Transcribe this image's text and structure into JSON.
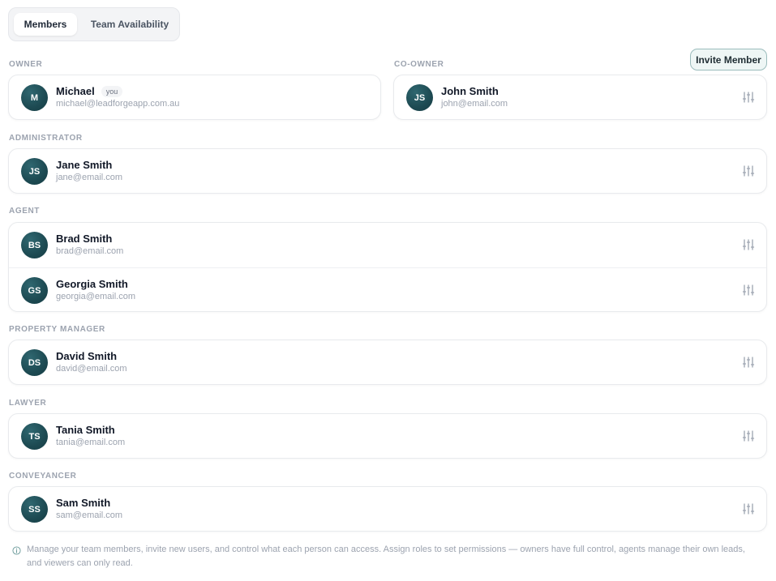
{
  "tabs": [
    {
      "label": "Members",
      "active": true
    },
    {
      "label": "Team Availability",
      "active": false
    }
  ],
  "invite_button": "Invite Member",
  "sections": {
    "owner": {
      "label": "OWNER",
      "members": [
        {
          "initials": "M",
          "name": "Michael",
          "badge": "you",
          "email": "michael@leadforgeapp.com.au"
        }
      ]
    },
    "co_owner": {
      "label": "CO-OWNER",
      "members": [
        {
          "initials": "JS",
          "name": "John Smith",
          "email": "john@email.com"
        }
      ]
    },
    "administrator": {
      "label": "ADMINISTRATOR",
      "members": [
        {
          "initials": "JS",
          "name": "Jane Smith",
          "email": "jane@email.com"
        }
      ]
    },
    "agent": {
      "label": "AGENT",
      "members": [
        {
          "initials": "BS",
          "name": "Brad Smith",
          "email": "brad@email.com"
        },
        {
          "initials": "GS",
          "name": "Georgia Smith",
          "email": "georgia@email.com"
        }
      ]
    },
    "property_manager": {
      "label": "PROPERTY MANAGER",
      "members": [
        {
          "initials": "DS",
          "name": "David Smith",
          "email": "david@email.com"
        }
      ]
    },
    "lawyer": {
      "label": "LAWYER",
      "members": [
        {
          "initials": "TS",
          "name": "Tania Smith",
          "email": "tania@email.com"
        }
      ]
    },
    "conveyancer": {
      "label": "CONVEYANCER",
      "members": [
        {
          "initials": "SS",
          "name": "Sam Smith",
          "email": "sam@email.com"
        }
      ]
    }
  },
  "info_text": "Manage your team members, invite new users, and control what each person can access. Assign roles to set permissions — owners have full control, agents manage their own leads, and viewers can only read.",
  "colors": {
    "avatar": "#1d4a52",
    "invite_border": "#9bbcbc",
    "invite_bg": "#eef6f5",
    "muted_text": "#9ca3af"
  },
  "icons": {
    "settings": "sliders-icon",
    "info": "info-icon"
  }
}
